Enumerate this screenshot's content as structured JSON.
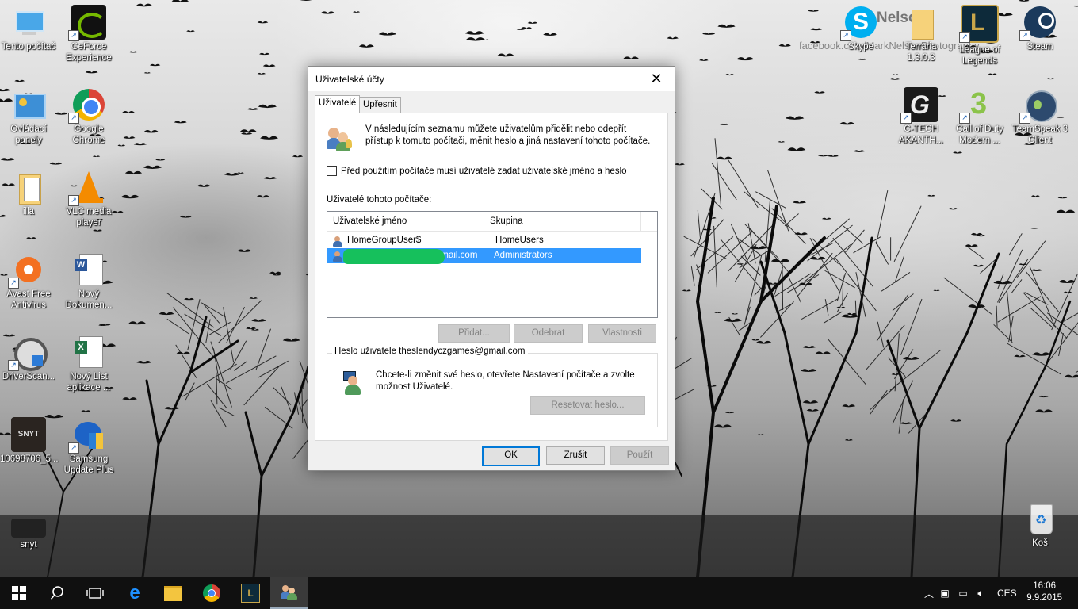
{
  "desktop": {
    "left_icons": [
      {
        "label": "Tento počítač",
        "icon": "this-pc-icon"
      },
      {
        "label": "GeForce Experience",
        "icon": "nvidia-icon"
      },
      {
        "label": "Ovládací panely",
        "icon": "control-panel-icon"
      },
      {
        "label": "Google Chrome",
        "icon": "chrome-icon"
      },
      {
        "label": "illa",
        "icon": "folder-icon"
      },
      {
        "label": "VLC media player",
        "icon": "vlc-icon"
      },
      {
        "label": "Avast Free Antivirus",
        "icon": "avast-icon"
      },
      {
        "label": "Nový Dokumen...",
        "icon": "word-document-icon"
      },
      {
        "label": "DriverScan...",
        "icon": "driverscanner-icon"
      },
      {
        "label": "Nový List aplikace ...",
        "icon": "excel-sheet-icon"
      },
      {
        "label": "10698706_5...",
        "icon": "image-file-icon"
      },
      {
        "label": "Samsung Update Plus",
        "icon": "samsung-update-icon"
      },
      {
        "label": "snyt",
        "icon": "image-file-icon"
      }
    ],
    "right_icons": [
      {
        "label": "Skype",
        "icon": "skype-icon"
      },
      {
        "label": "Terraria 1.3.0.3",
        "icon": "folder-icon"
      },
      {
        "label": "League of Legends",
        "icon": "league-icon"
      },
      {
        "label": "Steam",
        "icon": "steam-icon"
      },
      {
        "label": "C-TECH AKANTH...",
        "icon": "ctech-icon"
      },
      {
        "label": "Call of Duty Modern ...",
        "icon": "cod-icon"
      },
      {
        "label": "TeamSpeak 3 Client",
        "icon": "teamspeak-icon"
      },
      {
        "label": "Koš",
        "icon": "recycle-bin-icon"
      }
    ],
    "watermark": "facebook.com/MarkNelsonPhotography",
    "watermark_title": "k Nelson"
  },
  "dialog": {
    "title": "Uživatelské účty",
    "tabs": [
      "Uživatelé",
      "Upřesnit"
    ],
    "intro_text": "V následujícím seznamu můžete uživatelům přidělit nebo odepřít přístup k tomuto počítači, měnit heslo a jiná nastavení tohoto počítače.",
    "checkbox_label": "Před použitím počítače musí uživatelé zadat uživatelské jméno a heslo",
    "checkbox_checked": false,
    "list_label": "Uživatelé tohoto počítače:",
    "columns": [
      "Uživatelské jméno",
      "Skupina"
    ],
    "rows": [
      {
        "name": "HomeGroupUser$",
        "group": "HomeUsers",
        "selected": false
      },
      {
        "name": "gmail.com",
        "group": "Administrators",
        "selected": true
      }
    ],
    "buttons": {
      "add": "Přidat...",
      "remove": "Odebrat",
      "properties": "Vlastnosti",
      "reset_password": "Resetovat heslo...",
      "ok": "OK",
      "cancel": "Zrušit",
      "apply": "Použít"
    },
    "password_group": {
      "legend": "Heslo uživatele theslendyczgames@gmail.com",
      "text": "Chcete-li změnit své heslo, otevřete Nastavení počítače a zvolte možnost Uživatelé."
    }
  },
  "taskbar": {
    "language": "CES",
    "time": "16:06",
    "date": "9.9.2015"
  }
}
